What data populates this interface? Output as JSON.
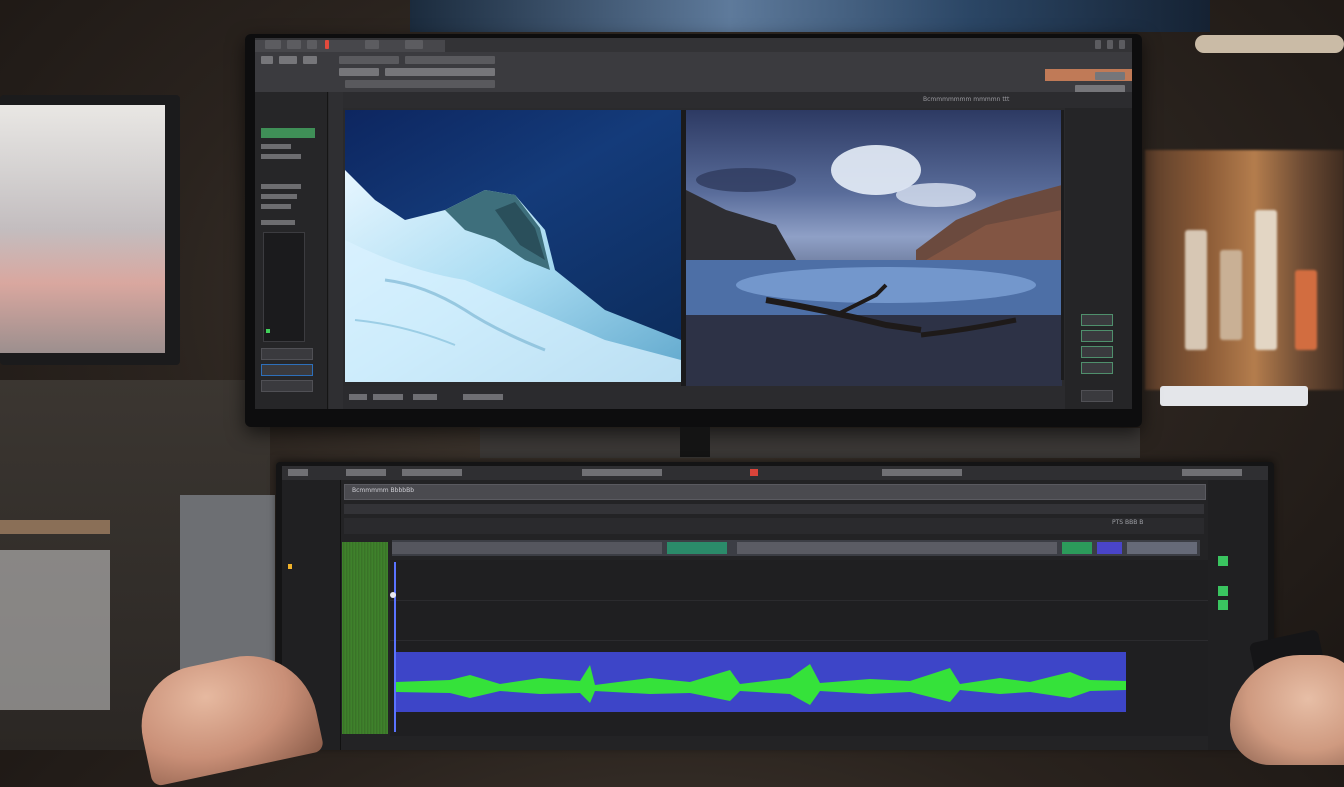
{
  "app": {
    "viewer_title": "Bcmmmmmmm mmmmn ttt",
    "editor_track_label": "Bcmmmmm BbbbBb",
    "editor_timecode": "PTS BBB B"
  },
  "colors": {
    "waveform_base": "#3d45c8",
    "waveform_green": "#35e23a",
    "timeline_accent": "#3ac560",
    "ui_dark": "#232325",
    "toolbar_accent": "#c07a57"
  },
  "icons": {
    "left_hand": "hand-icon",
    "right_hand": "hand-icon",
    "phone": "phone-icon"
  }
}
